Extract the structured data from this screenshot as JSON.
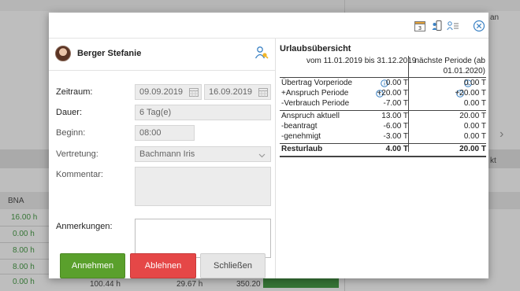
{
  "background": {
    "col_header": "BNA",
    "col_values": [
      "16.00 h",
      "0.00 h",
      "8.00 h",
      "8.00 h",
      "0.00 h"
    ],
    "bottom_values": [
      "100.44 h",
      "29.67 h",
      "350.20"
    ],
    "right_fragments": [
      "an",
      "kt"
    ]
  },
  "toolbar": {
    "calendar_badge": "3",
    "icons": [
      "calendar-icon",
      "mobile-user-icon",
      "user-list-icon",
      "close-icon"
    ]
  },
  "employee": {
    "name": "Berger Stefanie"
  },
  "form": {
    "zeitraum_label": "Zeitraum:",
    "date_from": "09.09.2019",
    "date_to": "16.09.2019",
    "dauer_label": "Dauer:",
    "dauer_value": "6 Tag(e)",
    "beginn_label": "Beginn:",
    "beginn_value": "08:00",
    "vertretung_label": "Vertretung:",
    "vertretung_value": "Bachmann Iris",
    "kommentar_label": "Kommentar:",
    "anmerkungen_label": "Anmerkungen:"
  },
  "buttons": {
    "accept": "Annehmen",
    "reject": "Ablehnen",
    "close": "Schließen"
  },
  "overview": {
    "title": "Urlaubsübersicht",
    "col1_header": "vom 11.01.2019 bis 31.12.2019",
    "col2_header_line1": "nächste Periode (ab",
    "col2_header_line2": "01.01.2020)",
    "rows": [
      {
        "name": "Übertrag Vorperiode",
        "v1": "0.00 T",
        "v2": "0.00 T"
      },
      {
        "name": "+Anspruch Periode",
        "v1": "+20.00 T",
        "v2": "+20.00 T"
      },
      {
        "name": "-Verbrauch Periode",
        "v1": "-7.00 T",
        "v2": "0.00 T"
      },
      {
        "name": "Anspruch aktuell",
        "v1": "13.00 T",
        "v2": "20.00 T"
      },
      {
        "name": "-beantragt",
        "v1": "-6.00 T",
        "v2": "0.00 T"
      },
      {
        "name": "-genehmigt",
        "v1": "-3.00 T",
        "v2": "0.00 T"
      },
      {
        "name": "Resturlaub",
        "v1": "4.00 T",
        "v2": "20.00 T"
      }
    ]
  },
  "colors": {
    "accept": "#5aa02c",
    "reject": "#e54747",
    "close": "#e6e6e6",
    "info": "#3b82c4"
  }
}
